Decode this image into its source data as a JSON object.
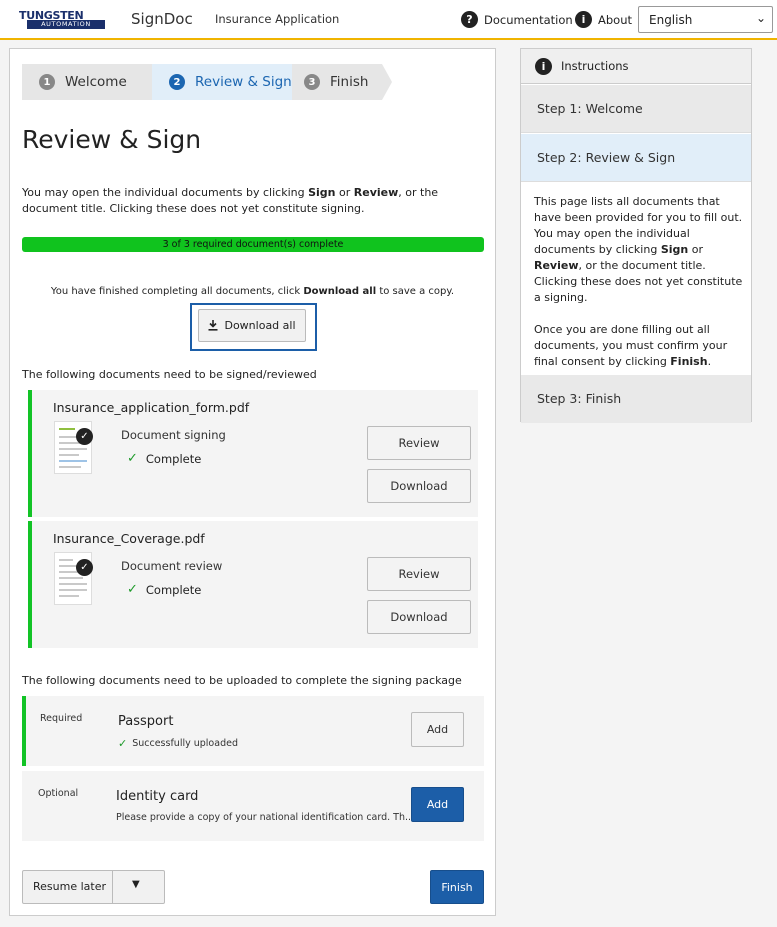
{
  "header": {
    "logo_top": "TUNGSTEN",
    "logo_bottom": "AUTOMATION",
    "app_name": "SignDoc",
    "app_subtitle": "Insurance Application",
    "documentation_label": "Documentation",
    "documentation_icon": "question-circle-icon",
    "about_label": "About",
    "about_icon": "info-circle-icon",
    "language": "English"
  },
  "stepper": [
    {
      "num": "1",
      "label": "Welcome"
    },
    {
      "num": "2",
      "label": "Review & Sign"
    },
    {
      "num": "3",
      "label": "Finish"
    }
  ],
  "main": {
    "title": "Review & Sign",
    "intro_part1": "You may open the individual documents by clicking ",
    "intro_sign": "Sign",
    "intro_or": " or ",
    "intro_review": "Review",
    "intro_part2": ", or the document title. Clicking these does not yet constitute signing.",
    "progress_text": "3 of 3 required document(s) complete",
    "progress_fraction": 1.0,
    "finished_part1": "You have finished completing all documents, click ",
    "finished_bold": "Download all",
    "finished_part2": " to save a copy.",
    "download_all_label": "Download all",
    "sign_section_label": "The following documents need to be signed/reviewed",
    "documents": [
      {
        "name": "Insurance_application_form.pdf",
        "type": "Document signing",
        "status": "Complete",
        "review_label": "Review",
        "download_label": "Download"
      },
      {
        "name": "Insurance_Coverage.pdf",
        "type": "Document review",
        "status": "Complete",
        "review_label": "Review",
        "download_label": "Download"
      }
    ],
    "upload_section_label": "The following documents need to be uploaded to complete the signing package",
    "uploads": [
      {
        "tag": "Required",
        "name": "Passport",
        "sub": "Successfully uploaded",
        "add_label": "Add"
      },
      {
        "tag": "Optional",
        "name": "Identity card",
        "sub": "Please provide a copy of your national identification card. Th...",
        "add_label": "Add"
      }
    ],
    "resume_label": "Resume later",
    "finish_label": "Finish"
  },
  "instructions": {
    "header": "Instructions",
    "step1": "Step 1: Welcome",
    "step2": "Step 2: Review & Sign",
    "step3": "Step 3: Finish",
    "p1_a": "This page lists all documents that have been provided for you to fill out. You may open the individual documents by clicking ",
    "p1_sign": "Sign",
    "p1_or": " or ",
    "p1_review": "Review",
    "p1_b": ", or the document title. Clicking these does not yet constitute a signing.",
    "p2_a": "Once you are done filling out all documents, you must confirm your final consent by clicking ",
    "p2_finish": "Finish",
    "p2_b": "."
  },
  "colors": {
    "accent": "#1c5ea8",
    "progress": "#10c31e",
    "header_border": "#f0b400",
    "active_step_bg": "#e1eef9"
  }
}
